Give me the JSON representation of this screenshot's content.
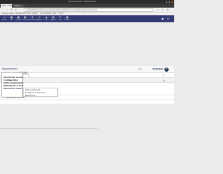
{
  "os": {
    "window_title": "Tiers et Contacts - Mozilla Firefox"
  },
  "browser": {
    "tabs": [
      {
        "label": "Tiers / Contacts"
      },
      {
        "label": "Dolibarr"
      }
    ],
    "url": "localhost/dolibarr/htdocs/product/stock/list.php?leftmenu=product&mainmenu=products",
    "bookmarks": [
      "Les plus visités",
      "Débuter avec Firefox",
      "Dolibarr",
      "Documentation",
      "Wiki",
      "Forum"
    ]
  },
  "app": {
    "top_menu": [
      {
        "label": "Accueil",
        "icon": "home-icon"
      },
      {
        "label": "Tiers",
        "icon": "building-icon"
      },
      {
        "label": "Produits",
        "icon": "box-icon"
      },
      {
        "label": "Commerce",
        "icon": "briefcase-icon"
      },
      {
        "label": "Facturation",
        "icon": "money-icon"
      },
      {
        "label": "Banque",
        "icon": "bank-icon"
      },
      {
        "label": "Projets",
        "icon": "project-icon"
      },
      {
        "label": "Agenda",
        "icon": "calendar-icon"
      },
      {
        "label": "Outils",
        "icon": "wrench-icon"
      },
      {
        "label": "Produits",
        "icon": "box-icon"
      }
    ],
    "page_title": "Équipements",
    "pager": "1/1",
    "new_button": "NOUVEAU",
    "plus_symbol": "+",
    "search_icon": "search-icon",
    "clear_icon": "close-icon",
    "dropdown": {
      "header": "AJOUTER",
      "items": [
        {
          "label": "Mes tâches de travail",
          "bold": true
        },
        {
          "label": "Configuration",
          "bold": true
        },
        {
          "label": "Outils d'administration",
          "bold": true
        },
        {
          "label": "Utilisateurs & Groupes",
          "bold": true
        },
        {
          "label": "Ressources Gelus",
          "bold": true
        }
      ]
    },
    "submenu": {
      "items": [
        {
          "label": "Temps de travail"
        },
        {
          "label": "Congés et la ressource"
        },
        {
          "label": "Ressources"
        }
      ]
    },
    "list_rows": [
      {
        "label": "1° élément de liste"
      },
      {
        "label": "Équipement libre  lien"
      }
    ]
  }
}
